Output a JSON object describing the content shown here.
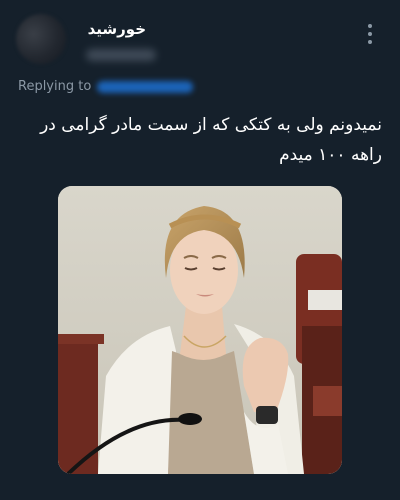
{
  "tweet": {
    "author": {
      "display_name": "خورشید",
      "avatar_icon": "avatar-image"
    },
    "reply_label": "Replying to",
    "text": "نمیدونم ولی به کتکی که از سمت مادر گرامی در راهه ۱۰۰ میدم",
    "more_icon": "more-vertical-icon",
    "media": {
      "type": "photo",
      "icon": "photo-image"
    }
  },
  "colors": {
    "background": "#15202b",
    "text": "#ffffff",
    "secondary_text": "#8b98a5",
    "link": "#1d9bf0"
  }
}
